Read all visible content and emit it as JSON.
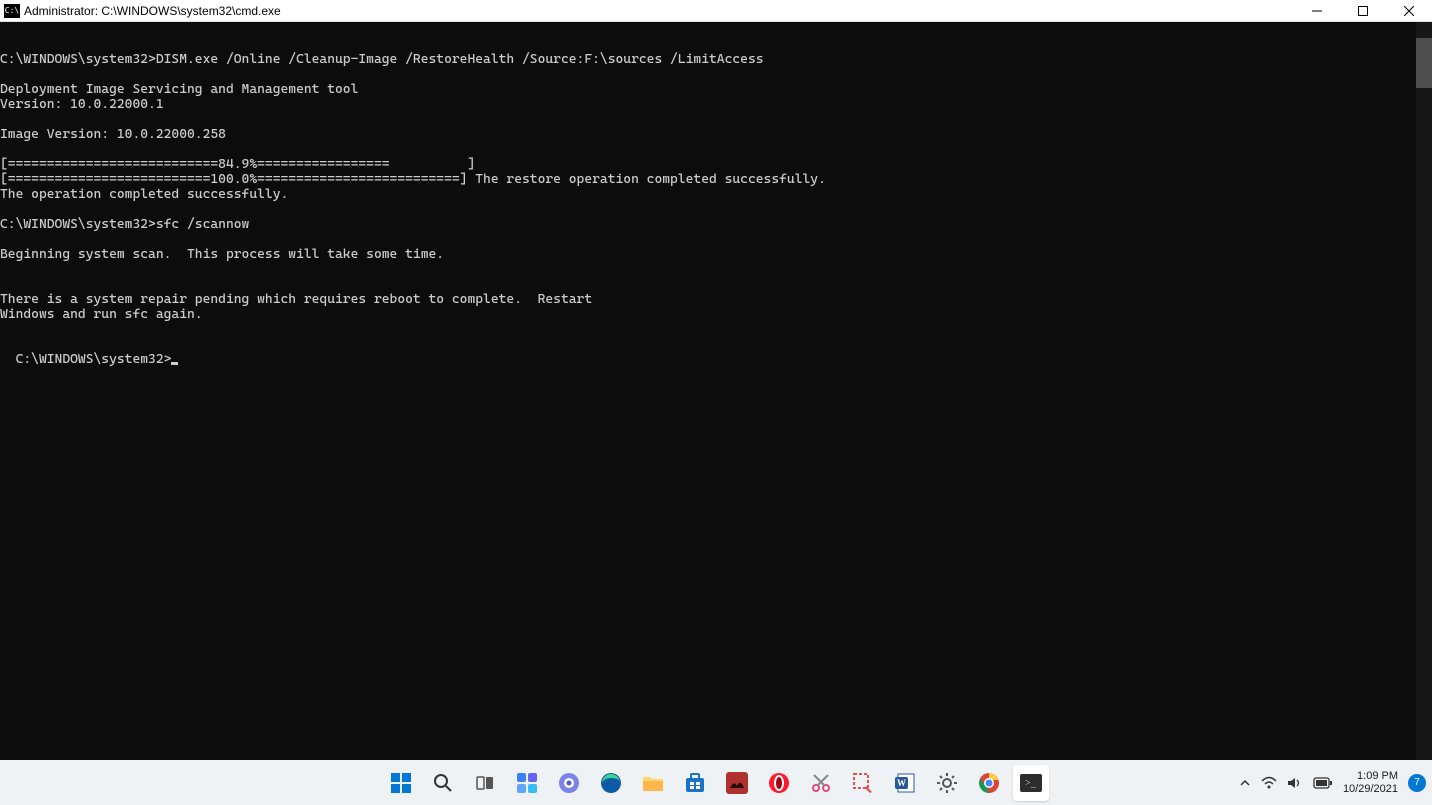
{
  "titlebar": {
    "icon_text": "C:\\",
    "title": "Administrator: C:\\WINDOWS\\system32\\cmd.exe"
  },
  "terminal": {
    "lines": [
      "C:\\WINDOWS\\system32>DISM.exe /Online /Cleanup-Image /RestoreHealth /Source:F:\\sources /LimitAccess",
      "",
      "Deployment Image Servicing and Management tool",
      "Version: 10.0.22000.1",
      "",
      "Image Version: 10.0.22000.258",
      "",
      "[===========================84.9%=================          ]",
      "[==========================100.0%==========================] The restore operation completed successfully.",
      "The operation completed successfully.",
      "",
      "C:\\WINDOWS\\system32>sfc /scannow",
      "",
      "Beginning system scan.  This process will take some time.",
      "",
      "",
      "There is a system repair pending which requires reboot to complete.  Restart",
      "Windows and run sfc again.",
      ""
    ],
    "current_prompt": "C:\\WINDOWS\\system32>"
  },
  "taskbar": {
    "icons": [
      "start",
      "search",
      "task-view",
      "widgets",
      "teams",
      "edge",
      "file-explorer",
      "microsoft-store",
      "app-red",
      "opera",
      "snip",
      "screen-sketch",
      "word",
      "settings",
      "chrome",
      "terminal"
    ]
  },
  "tray": {
    "time": "1:09 PM",
    "date": "10/29/2021",
    "notifications": "7"
  }
}
